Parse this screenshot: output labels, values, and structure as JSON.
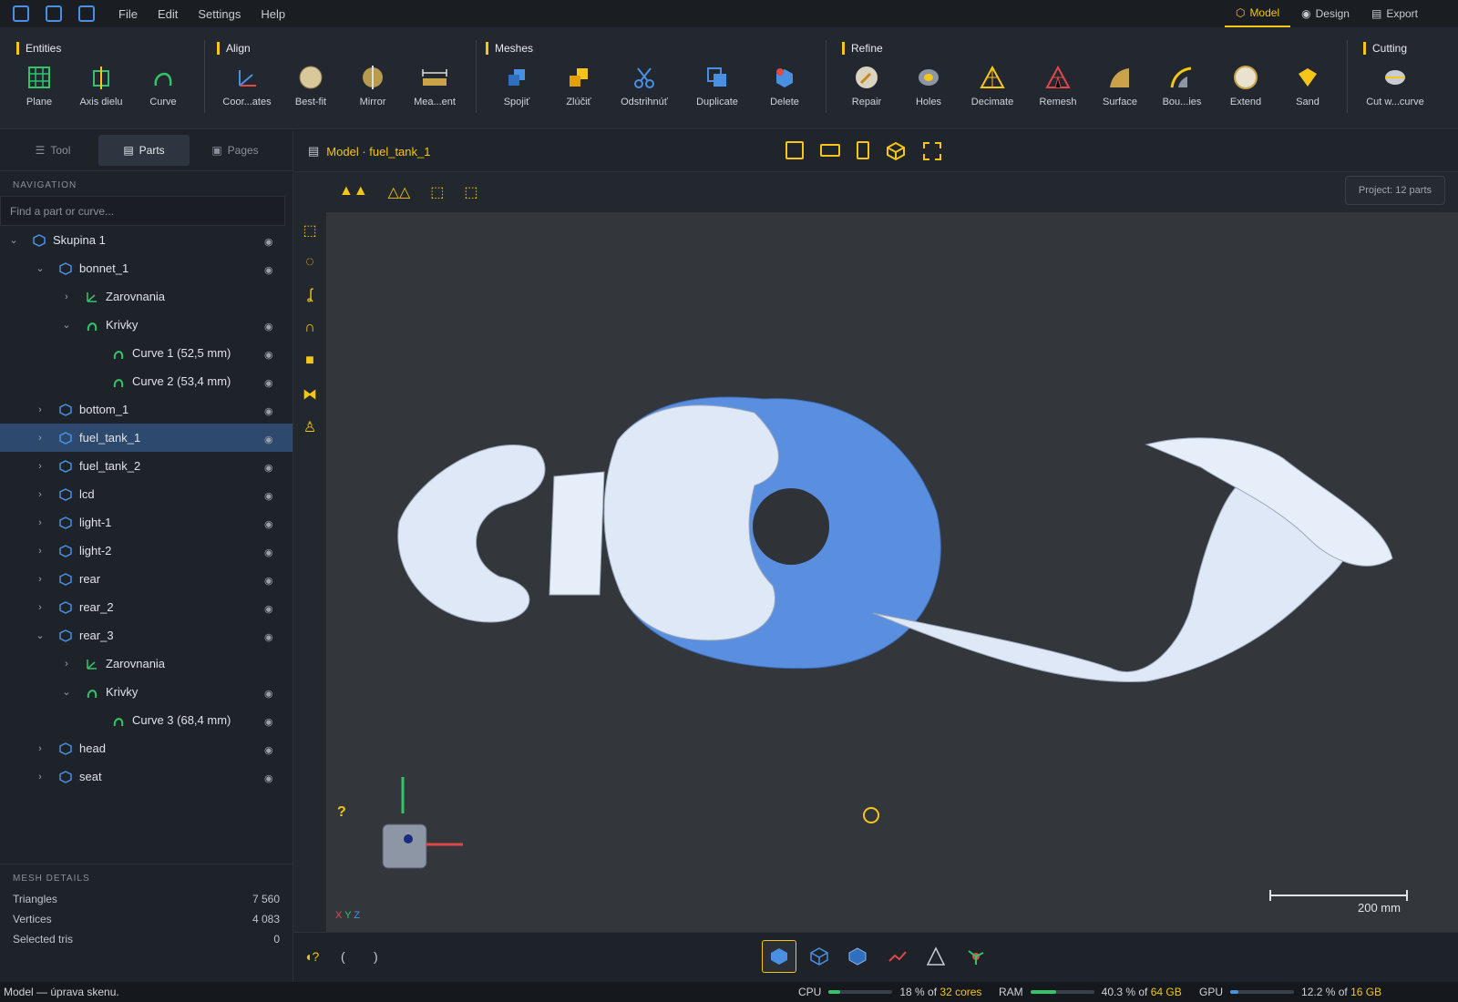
{
  "menu": [
    "File",
    "Edit",
    "Settings",
    "Help"
  ],
  "modes": [
    {
      "label": "Model",
      "active": true
    },
    {
      "label": "Design",
      "active": false
    },
    {
      "label": "Export",
      "active": false
    }
  ],
  "ribbon": {
    "groups": {
      "entities": "Entities",
      "align": "Align",
      "meshes": "Meshes",
      "refine": "Refine",
      "cutting": "Cutting"
    },
    "tools": {
      "plane": "Plane",
      "axis": "Axis dielu",
      "curve": "Curve",
      "coord": "Coor...ates",
      "bestfit": "Best-fit",
      "mirror": "Mirror",
      "measurement": "Mea...ent",
      "spojit": "Spojiť",
      "zlucit": "Zlúčiť",
      "odstrihnut": "Odstrihnúť",
      "duplicate": "Duplicate",
      "delete": "Delete",
      "repair": "Repair",
      "holes": "Holes",
      "decimate": "Decimate",
      "remesh": "Remesh",
      "surface": "Surface",
      "boundaries": "Bou...ies",
      "extend": "Extend",
      "sand": "Sand",
      "cutwithcurve": "Cut w...curve"
    }
  },
  "panel": {
    "tabs": {
      "tool": "Tool",
      "parts": "Parts",
      "pages": "Pages"
    },
    "navigation": "NAVIGATION",
    "search_placeholder": "Find a part or curve...",
    "tree": [
      {
        "label": "Skupina 1",
        "indent": 0,
        "chev": "v",
        "icon": "part",
        "eye": true
      },
      {
        "label": "bonnet_1",
        "indent": 1,
        "chev": "v",
        "icon": "part",
        "eye": true
      },
      {
        "label": "Zarovnania",
        "indent": 2,
        "chev": ">",
        "icon": "axis",
        "eye": false
      },
      {
        "label": "Krivky",
        "indent": 2,
        "chev": "v",
        "icon": "curve",
        "eye": true
      },
      {
        "label": "Curve 1  (52,5 mm)",
        "indent": 3,
        "chev": "",
        "icon": "curve",
        "eye": true
      },
      {
        "label": "Curve 2  (53,4 mm)",
        "indent": 3,
        "chev": "",
        "icon": "curve",
        "eye": true
      },
      {
        "label": "bottom_1",
        "indent": 1,
        "chev": ">",
        "icon": "part",
        "eye": true
      },
      {
        "label": "fuel_tank_1",
        "indent": 1,
        "chev": ">",
        "icon": "part",
        "eye": true,
        "selected": true
      },
      {
        "label": "fuel_tank_2",
        "indent": 1,
        "chev": ">",
        "icon": "part",
        "eye": true
      },
      {
        "label": "lcd",
        "indent": 1,
        "chev": ">",
        "icon": "part",
        "eye": true
      },
      {
        "label": "light-1",
        "indent": 1,
        "chev": ">",
        "icon": "part",
        "eye": true
      },
      {
        "label": "light-2",
        "indent": 1,
        "chev": ">",
        "icon": "part",
        "eye": true
      },
      {
        "label": "rear",
        "indent": 1,
        "chev": ">",
        "icon": "part",
        "eye": true
      },
      {
        "label": "rear_2",
        "indent": 1,
        "chev": ">",
        "icon": "part",
        "eye": true
      },
      {
        "label": "rear_3",
        "indent": 1,
        "chev": "v",
        "icon": "part",
        "eye": true
      },
      {
        "label": "Zarovnania",
        "indent": 2,
        "chev": ">",
        "icon": "axis",
        "eye": false
      },
      {
        "label": "Krivky",
        "indent": 2,
        "chev": "v",
        "icon": "curve",
        "eye": true
      },
      {
        "label": "Curve 3  (68,4 mm)",
        "indent": 3,
        "chev": "",
        "icon": "curve",
        "eye": true
      },
      {
        "label": "head",
        "indent": 1,
        "chev": ">",
        "icon": "part",
        "eye": true
      },
      {
        "label": "seat",
        "indent": 1,
        "chev": ">",
        "icon": "part",
        "eye": true
      }
    ],
    "mesh_details": {
      "title": "MESH DETAILS",
      "triangles_label": "Triangles",
      "triangles": "7 560",
      "vertices_label": "Vertices",
      "vertices": "4 083",
      "selected_label": "Selected tris",
      "selected": "0"
    }
  },
  "viewport": {
    "title": "Model · fuel_tank_1",
    "project": "Project: 12 parts",
    "scale": "200 mm",
    "axes_label_x": "X",
    "axes_label_y": "Y",
    "axes_label_z": "Z",
    "help": "?"
  },
  "status": {
    "message": "Model — úprava skenu.",
    "cpu_label": "CPU",
    "cpu_pct": "18 % of",
    "cpu_total": "32 cores",
    "cpu_value": 0.18,
    "ram_label": "RAM",
    "ram_pct": "40.3 % of",
    "ram_total": "64 GB",
    "ram_value": 0.403,
    "gpu_label": "GPU",
    "gpu_pct": "12.2 % of",
    "gpu_total": "16 GB",
    "gpu_value": 0.122
  },
  "colors": {
    "accent": "#f5c518",
    "selection": "#2d4a6e",
    "part_blue": "#5a8fe0",
    "curve_green": "#33c46a"
  }
}
